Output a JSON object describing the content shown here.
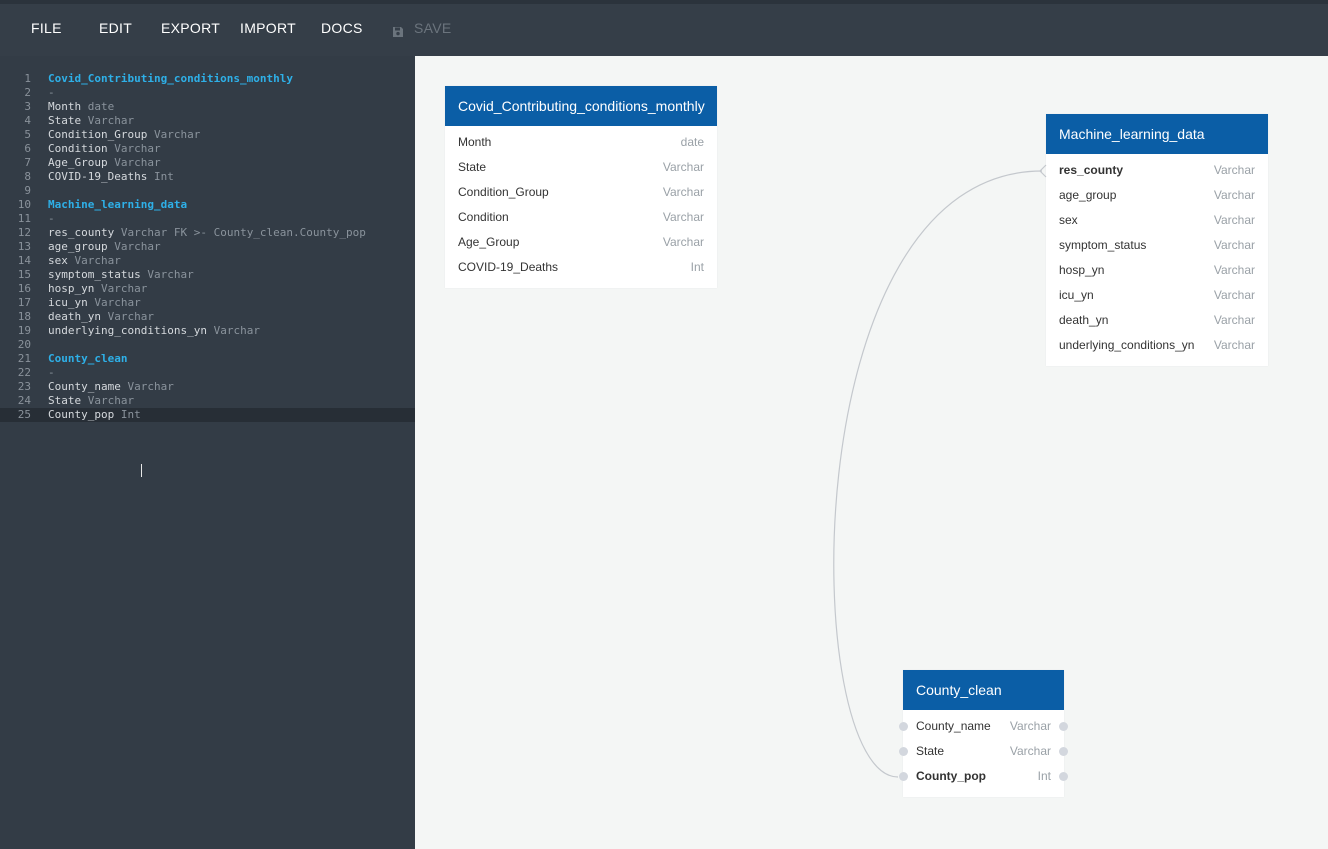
{
  "menu": {
    "file": "FILE",
    "edit": "EDIT",
    "export": "EXPORT",
    "import": "IMPORT",
    "docs": "DOCS",
    "save": "SAVE",
    "save_icon": "floppy-disk-icon"
  },
  "editor": {
    "lines": [
      {
        "n": "1",
        "parts": [
          {
            "cls": "tbl",
            "t": "Covid_Contributing_conditions_monthly"
          }
        ]
      },
      {
        "n": "2",
        "parts": [
          {
            "cls": "dash",
            "t": "-"
          }
        ]
      },
      {
        "n": "3",
        "parts": [
          {
            "cls": "",
            "t": "Month "
          },
          {
            "cls": "ty",
            "t": "date"
          }
        ]
      },
      {
        "n": "4",
        "parts": [
          {
            "cls": "",
            "t": "State "
          },
          {
            "cls": "ty",
            "t": "Varchar"
          }
        ]
      },
      {
        "n": "5",
        "parts": [
          {
            "cls": "",
            "t": "Condition_Group "
          },
          {
            "cls": "ty",
            "t": "Varchar"
          }
        ]
      },
      {
        "n": "6",
        "parts": [
          {
            "cls": "",
            "t": "Condition "
          },
          {
            "cls": "ty",
            "t": "Varchar"
          }
        ]
      },
      {
        "n": "7",
        "parts": [
          {
            "cls": "",
            "t": "Age_Group "
          },
          {
            "cls": "ty",
            "t": "Varchar"
          }
        ]
      },
      {
        "n": "8",
        "parts": [
          {
            "cls": "",
            "t": "COVID-19_Deaths "
          },
          {
            "cls": "ty",
            "t": "Int"
          }
        ]
      },
      {
        "n": "9",
        "parts": []
      },
      {
        "n": "10",
        "parts": [
          {
            "cls": "tbl",
            "t": "Machine_learning_data"
          }
        ]
      },
      {
        "n": "11",
        "parts": [
          {
            "cls": "dash",
            "t": "-"
          }
        ]
      },
      {
        "n": "12",
        "parts": [
          {
            "cls": "",
            "t": "res_county "
          },
          {
            "cls": "ty",
            "t": "Varchar FK >- County_clean.County_pop"
          }
        ]
      },
      {
        "n": "13",
        "parts": [
          {
            "cls": "",
            "t": "age_group "
          },
          {
            "cls": "ty",
            "t": "Varchar"
          }
        ]
      },
      {
        "n": "14",
        "parts": [
          {
            "cls": "",
            "t": "sex "
          },
          {
            "cls": "ty",
            "t": "Varchar"
          }
        ]
      },
      {
        "n": "15",
        "parts": [
          {
            "cls": "",
            "t": "symptom_status "
          },
          {
            "cls": "ty",
            "t": "Varchar"
          }
        ]
      },
      {
        "n": "16",
        "parts": [
          {
            "cls": "",
            "t": "hosp_yn "
          },
          {
            "cls": "ty",
            "t": "Varchar"
          }
        ]
      },
      {
        "n": "17",
        "parts": [
          {
            "cls": "",
            "t": "icu_yn "
          },
          {
            "cls": "ty",
            "t": "Varchar"
          }
        ]
      },
      {
        "n": "18",
        "parts": [
          {
            "cls": "",
            "t": "death_yn "
          },
          {
            "cls": "ty",
            "t": "Varchar"
          }
        ]
      },
      {
        "n": "19",
        "parts": [
          {
            "cls": "",
            "t": "underlying_conditions_yn "
          },
          {
            "cls": "ty",
            "t": "Varchar"
          }
        ]
      },
      {
        "n": "20",
        "parts": []
      },
      {
        "n": "21",
        "parts": [
          {
            "cls": "tbl",
            "t": "County_clean"
          }
        ]
      },
      {
        "n": "22",
        "parts": [
          {
            "cls": "dash",
            "t": "-"
          }
        ]
      },
      {
        "n": "23",
        "parts": [
          {
            "cls": "",
            "t": "County_name "
          },
          {
            "cls": "ty",
            "t": "Varchar"
          }
        ]
      },
      {
        "n": "24",
        "parts": [
          {
            "cls": "",
            "t": "State "
          },
          {
            "cls": "ty",
            "t": "Varchar"
          }
        ]
      },
      {
        "n": "25",
        "parts": [
          {
            "cls": "",
            "t": "County_pop "
          },
          {
            "cls": "ty",
            "t": "Int"
          }
        ]
      }
    ]
  },
  "diagram": {
    "tables": [
      {
        "id": "covid",
        "name": "Covid_Contributing_conditions_monthly",
        "fields": [
          {
            "name": "Month",
            "type": "date",
            "key": false
          },
          {
            "name": "State",
            "type": "Varchar",
            "key": false
          },
          {
            "name": "Condition_Group",
            "type": "Varchar",
            "key": false
          },
          {
            "name": "Condition",
            "type": "Varchar",
            "key": false
          },
          {
            "name": "Age_Group",
            "type": "Varchar",
            "key": false
          },
          {
            "name": "COVID-19_Deaths",
            "type": "Int",
            "key": false
          }
        ]
      },
      {
        "id": "ml",
        "name": "Machine_learning_data",
        "fields": [
          {
            "name": "res_county",
            "type": "Varchar",
            "key": true
          },
          {
            "name": "age_group",
            "type": "Varchar",
            "key": false
          },
          {
            "name": "sex",
            "type": "Varchar",
            "key": false
          },
          {
            "name": "symptom_status",
            "type": "Varchar",
            "key": false
          },
          {
            "name": "hosp_yn",
            "type": "Varchar",
            "key": false
          },
          {
            "name": "icu_yn",
            "type": "Varchar",
            "key": false
          },
          {
            "name": "death_yn",
            "type": "Varchar",
            "key": false
          },
          {
            "name": "underlying_conditions_yn",
            "type": "Varchar",
            "key": false
          }
        ]
      },
      {
        "id": "county",
        "name": "County_clean",
        "fields": [
          {
            "name": "County_name",
            "type": "Varchar",
            "key": false
          },
          {
            "name": "State",
            "type": "Varchar",
            "key": false
          },
          {
            "name": "County_pop",
            "type": "Int",
            "key": true
          }
        ]
      }
    ]
  },
  "colors": {
    "accent": "#0b5ea6",
    "editor_bg": "#333c46",
    "toolbar_bg": "#353e48",
    "table_name_in_code": "#2eb0e8"
  }
}
